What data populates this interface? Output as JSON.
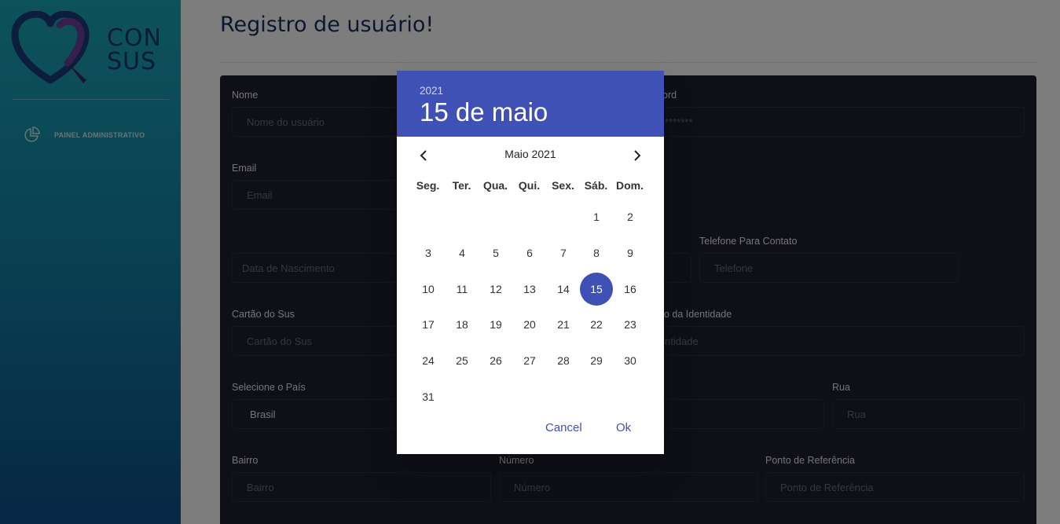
{
  "brand": {
    "line1": "CON",
    "line2": "SUS"
  },
  "sidebar": {
    "items": [
      {
        "label": "PAINEL ADMINISTRATIVO",
        "icon": "pie-chart-icon"
      }
    ]
  },
  "page": {
    "title": "Registro de usuário!"
  },
  "form": {
    "nome": {
      "label": "Nome",
      "placeholder": "Nome do usuário"
    },
    "password": {
      "label_visible": "ord",
      "value": "*******"
    },
    "email": {
      "label": "Email",
      "placeholder": "Email"
    },
    "data_nascimento": {
      "placeholder": "Data de Nascimento"
    },
    "telefone": {
      "label": "Telefone Para Contato",
      "placeholder": "Telefone"
    },
    "cartao_sus": {
      "label": "Cartão do Sus",
      "placeholder": "Cartão do Sus"
    },
    "identidade": {
      "label_visible": "o da Identidade",
      "placeholder_visible": "ntidade"
    },
    "pais": {
      "label": "Selecione o País",
      "value": "Brasil"
    },
    "rua": {
      "label": "Rua",
      "placeholder": "Rua"
    },
    "bairro": {
      "label": "Bairro",
      "placeholder": "Bairro"
    },
    "numero": {
      "label": "Número",
      "placeholder": "Número"
    },
    "referencia": {
      "label": "Ponto de Referência",
      "placeholder": "Ponto de Referência"
    }
  },
  "picker": {
    "year": "2021",
    "selected_date_label": "15 de maio",
    "month_label": "Maio 2021",
    "weekdays": [
      "Seg.",
      "Ter.",
      "Qua.",
      "Qui.",
      "Sex.",
      "Sáb.",
      "Dom."
    ],
    "weeks": [
      [
        "",
        "",
        "",
        "",
        "",
        "1",
        "2"
      ],
      [
        "3",
        "4",
        "5",
        "6",
        "7",
        "8",
        "9"
      ],
      [
        "10",
        "11",
        "12",
        "13",
        "14",
        "15",
        "16"
      ],
      [
        "17",
        "18",
        "19",
        "20",
        "21",
        "22",
        "23"
      ],
      [
        "24",
        "25",
        "26",
        "27",
        "28",
        "29",
        "30"
      ],
      [
        "31",
        "",
        "",
        "",
        "",
        "",
        ""
      ]
    ],
    "selected_day": "15",
    "cancel_label": "Cancel",
    "ok_label": "Ok",
    "accent_color": "#3f51b5"
  }
}
